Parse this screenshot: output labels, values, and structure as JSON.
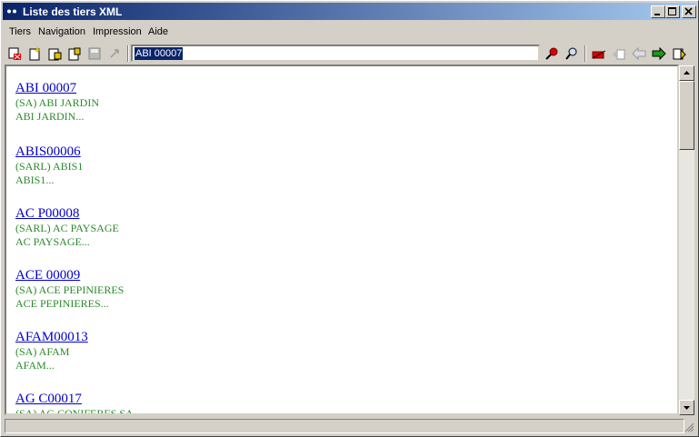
{
  "window": {
    "title": "Liste des tiers XML"
  },
  "menu": [
    {
      "label": "Tiers"
    },
    {
      "label": "Navigation"
    },
    {
      "label": "Impression"
    },
    {
      "label": "Aide"
    }
  ],
  "toolbar": {
    "search_value": "ABI 00007",
    "icons": [
      "close-record-icon",
      "new-record-icon",
      "add-record-icon",
      "edit-record-icon",
      "save-icon",
      "undo-icon",
      "find-icon",
      "zoom-icon",
      "first-icon",
      "previous-page-icon",
      "previous-icon",
      "next-icon",
      "last-icon"
    ]
  },
  "entries": [
    {
      "code": "ABI 00007",
      "line1": "(SA) ABI JARDIN",
      "line2": "ABI JARDIN..."
    },
    {
      "code": "ABIS00006",
      "line1": "(SARL) ABIS1",
      "line2": "ABIS1..."
    },
    {
      "code": "AC P00008",
      "line1": "(SARL) AC PAYSAGE",
      "line2": "AC PAYSAGE..."
    },
    {
      "code": "ACE 00009",
      "line1": "(SA) ACE PEPINIERES",
      "line2": "ACE PEPINIERES..."
    },
    {
      "code": "AFAM00013",
      "line1": "(SA) AFAM",
      "line2": "AFAM..."
    },
    {
      "code": "AG C00017",
      "line1": "(SA) AG CONIFERES SA",
      "line2": ""
    }
  ],
  "colors": {
    "title_start": "#0a246a",
    "title_end": "#a6caf0",
    "link": "#0000cc",
    "detail": "#2a8a2a",
    "selection": "#0a246a"
  }
}
